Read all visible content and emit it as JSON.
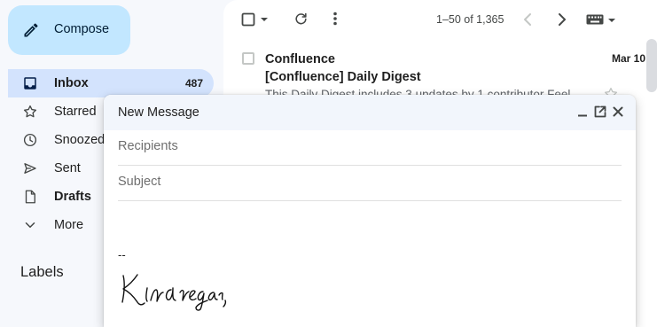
{
  "sidebar": {
    "compose_label": "Compose",
    "items": [
      {
        "label": "Inbox",
        "count": "487",
        "icon": "inbox-icon"
      },
      {
        "label": "Starred",
        "icon": "star-icon"
      },
      {
        "label": "Snoozed",
        "icon": "clock-icon"
      },
      {
        "label": "Sent",
        "icon": "send-icon"
      },
      {
        "label": "Drafts",
        "icon": "draft-icon"
      },
      {
        "label": "More",
        "icon": "chevron-down-icon"
      }
    ],
    "labels_heading": "Labels"
  },
  "toolbar": {
    "pager": "1–50 of 1,365"
  },
  "email": {
    "sender": "Confluence",
    "date": "Mar 10",
    "subject": "[Confluence] Daily Digest",
    "snippet": "This Daily Digest includes 3 updates by 1 contributor Feel"
  },
  "compose": {
    "title": "New Message",
    "recipients_placeholder": "Recipients",
    "subject_placeholder": "Subject",
    "signature_dash": "--",
    "signature_text": "Kind regards,"
  },
  "colors": {
    "compose_button": "#c2e7ff",
    "active_nav": "#d3e3fd",
    "background": "#f6f8fc"
  }
}
